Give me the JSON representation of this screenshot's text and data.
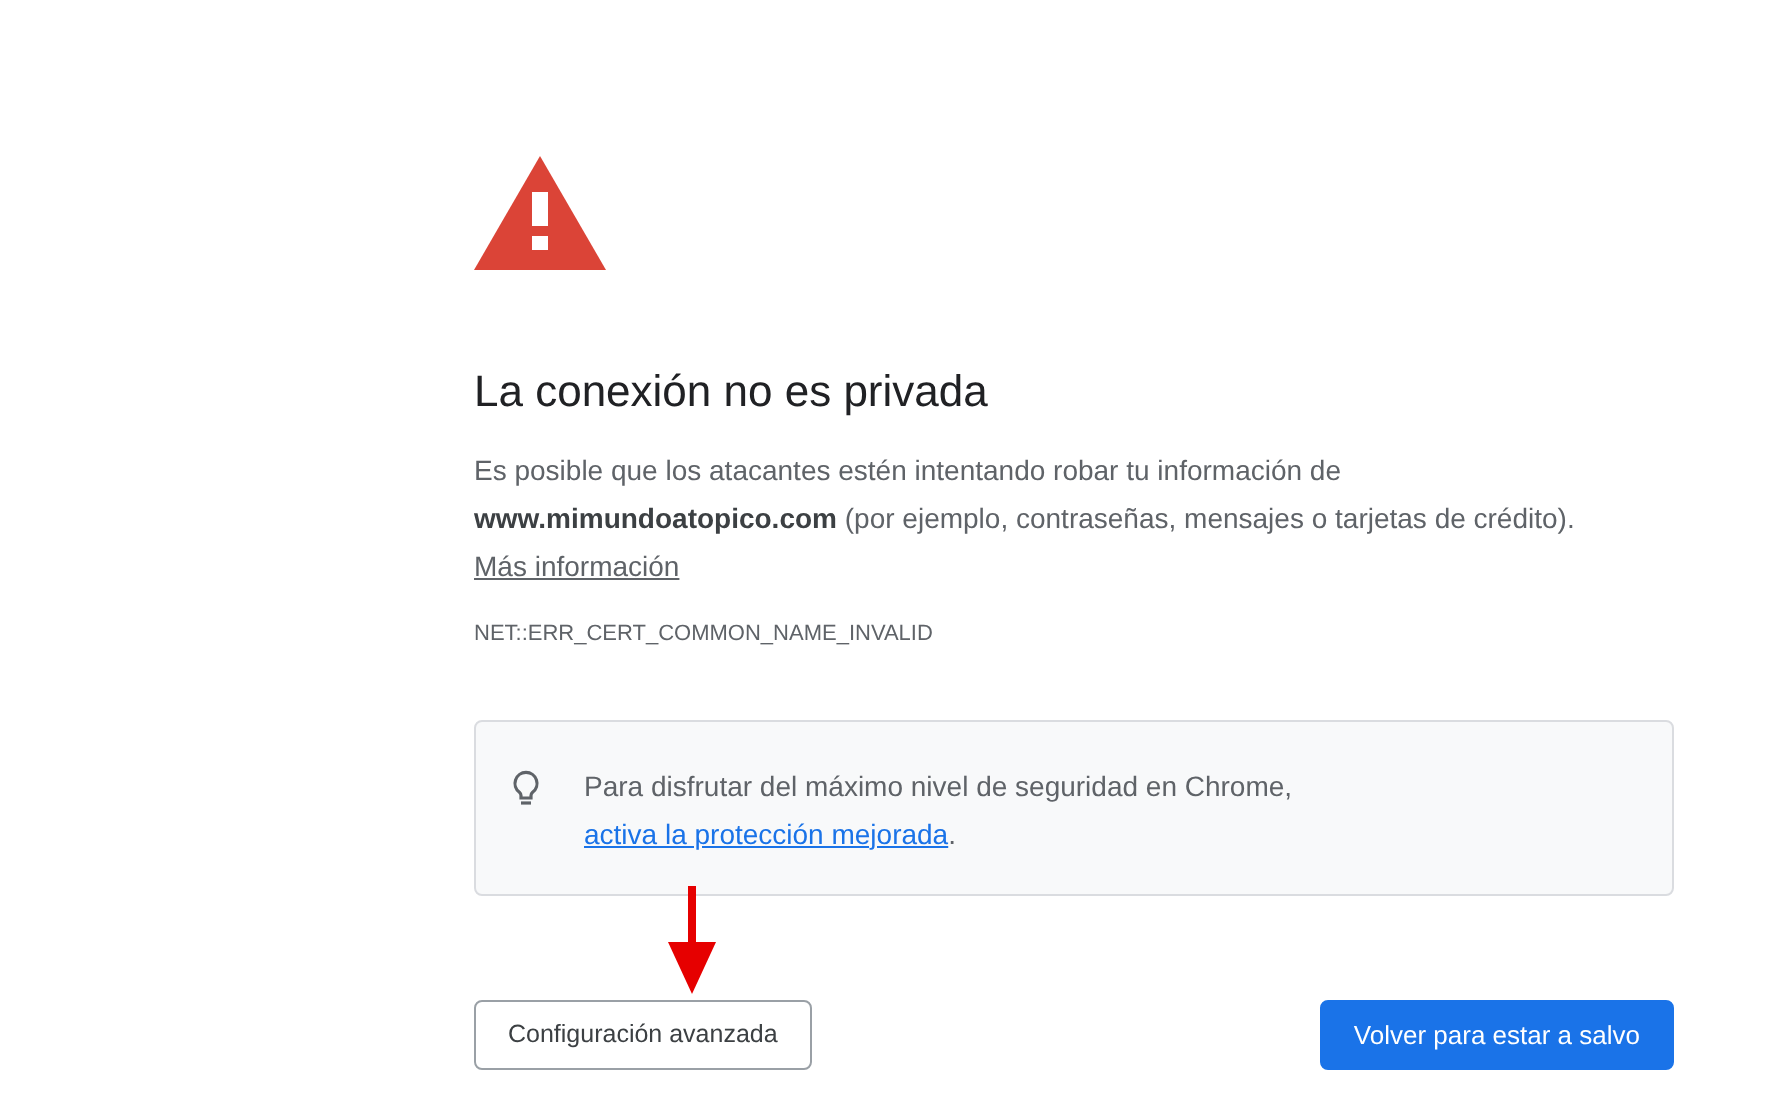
{
  "heading": "La conexión no es privada",
  "description": "Es posible que los atacantes estén intentando robar tu información de **www.mimundoatopico.com** (por ejemplo, contraseñas, mensajes o tarjetas de crédito).",
  "more_info_link": "Más información",
  "error_code": "NET::ERR_CERT_COMMON_NAME_INVALID",
  "tip": {
    "text": "Para disfrutar del máximo nivel de seguridad en Chrome,",
    "link": "activa la protección mejorada",
    "suffix": "."
  },
  "buttons": [
    {
      "label": "Configuración avanzada",
      "kind": "secondary"
    },
    {
      "label": "Volver para estar a salvo",
      "kind": "primary"
    }
  ]
}
